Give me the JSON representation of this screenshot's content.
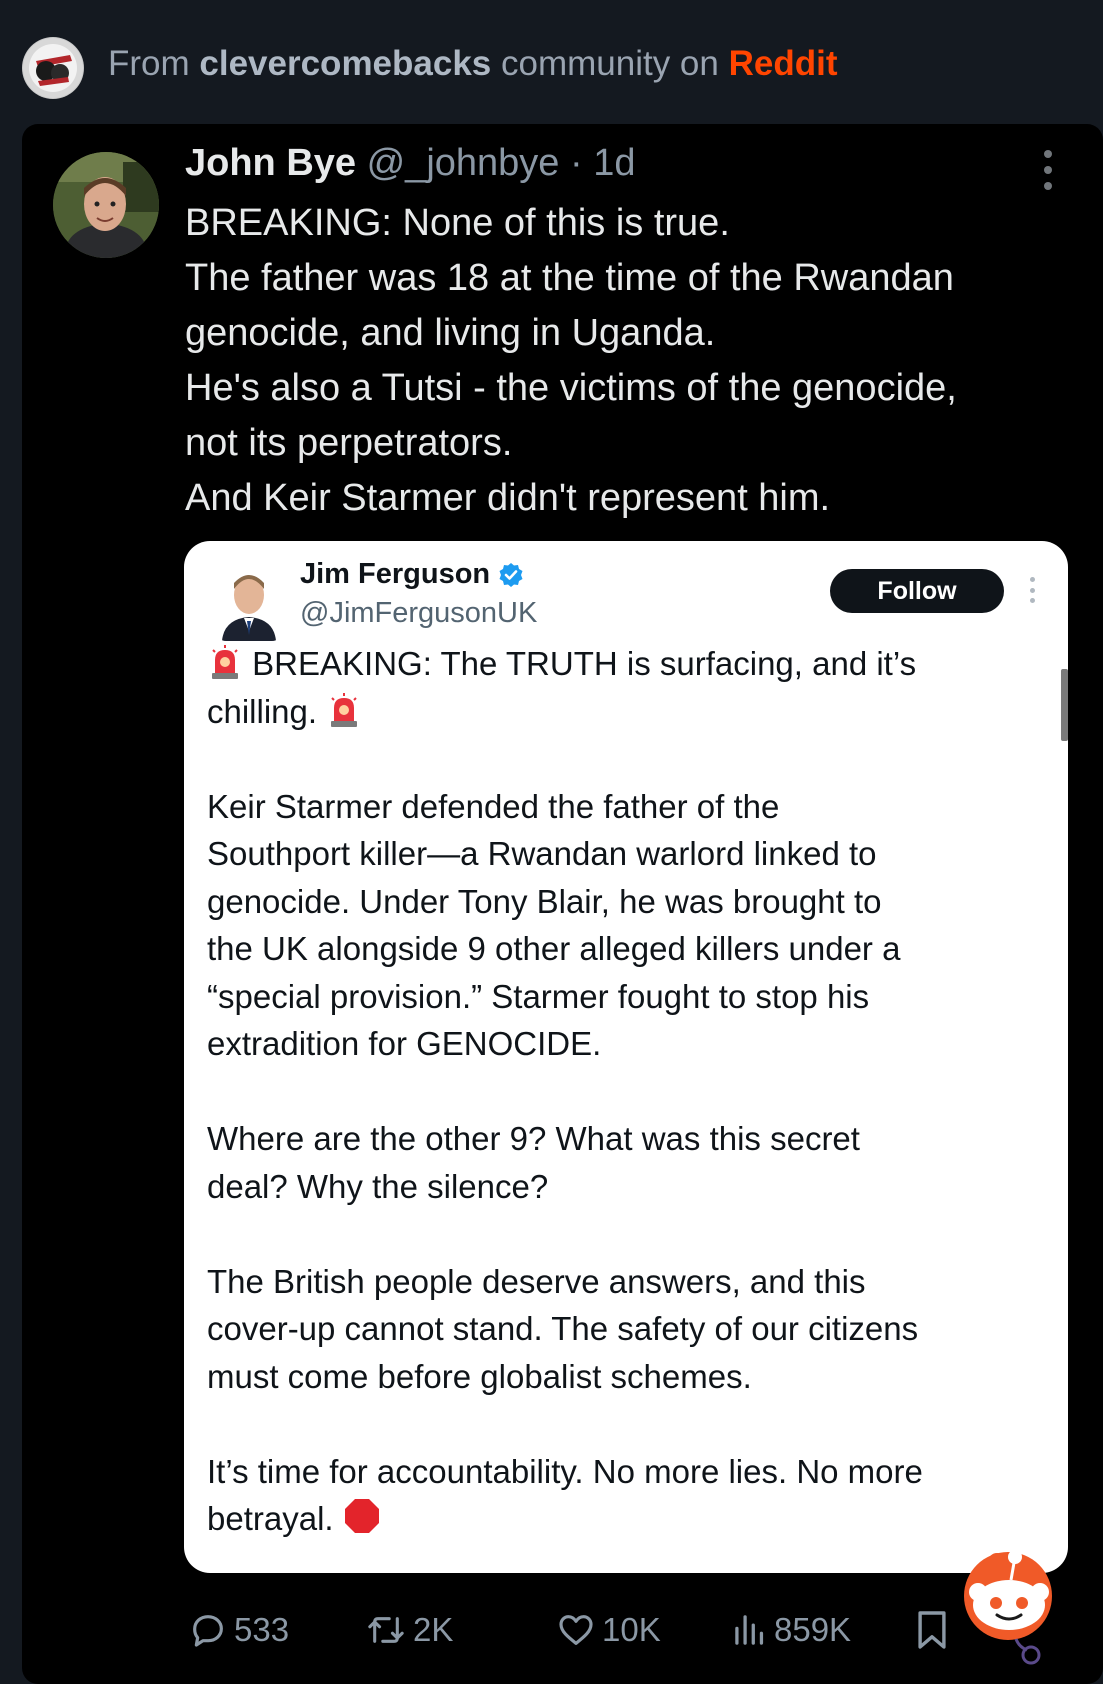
{
  "header": {
    "prefix": "From ",
    "community": "clevercomebacks",
    "middle": " community on ",
    "platform": "Reddit"
  },
  "tweet": {
    "name": "John Bye",
    "handle": "@_johnbye",
    "sep": " · ",
    "time": "1d",
    "lines": [
      "BREAKING: None of this is true.",
      "The father was 18 at the time of the Rwandan",
      "genocide, and living in Uganda.",
      "He's also a Tutsi - the victims of the genocide,",
      "not its perpetrators.",
      "And Keir Starmer didn't represent him."
    ]
  },
  "quote": {
    "name": "Jim Ferguson",
    "handle": "@JimFergusonUK",
    "follow_label": "Follow",
    "p1_l1": "BREAKING: The TRUTH is surfacing, and it’s",
    "p1_l2": "chilling.",
    "p2": [
      "Keir Starmer defended the father of the",
      "Southport killer—a Rwandan warlord linked to",
      "genocide. Under Tony Blair, he was brought to",
      "the UK alongside 9 other alleged killers under a",
      "“special provision.” Starmer fought to stop his",
      "extradition for GENOCIDE."
    ],
    "p3": [
      "Where are the other 9? What was this secret",
      "deal? Why the silence?"
    ],
    "p4": [
      "The British people deserve answers, and this",
      "cover-up cannot stand. The safety of our citizens",
      "must come before globalist schemes."
    ],
    "p5_l1": "It’s time for accountability. No more lies. No more",
    "p5_l2": "betrayal."
  },
  "actions": {
    "replies": "533",
    "reposts": "2K",
    "likes": "10K",
    "views": "859K"
  },
  "icons": {
    "reply": "reply-icon",
    "repost": "repost-icon",
    "like": "heart-icon",
    "views": "views-icon",
    "bookmark": "bookmark-icon",
    "siren": "siren-emoji-icon",
    "stop": "stop-sign-emoji-icon",
    "verified": "verified-badge-icon",
    "snoo": "reddit-snoo-icon"
  },
  "colors": {
    "reddit": "#ff4500",
    "verified": "#1d9bf0",
    "background": "#141920",
    "card": "#000000"
  }
}
